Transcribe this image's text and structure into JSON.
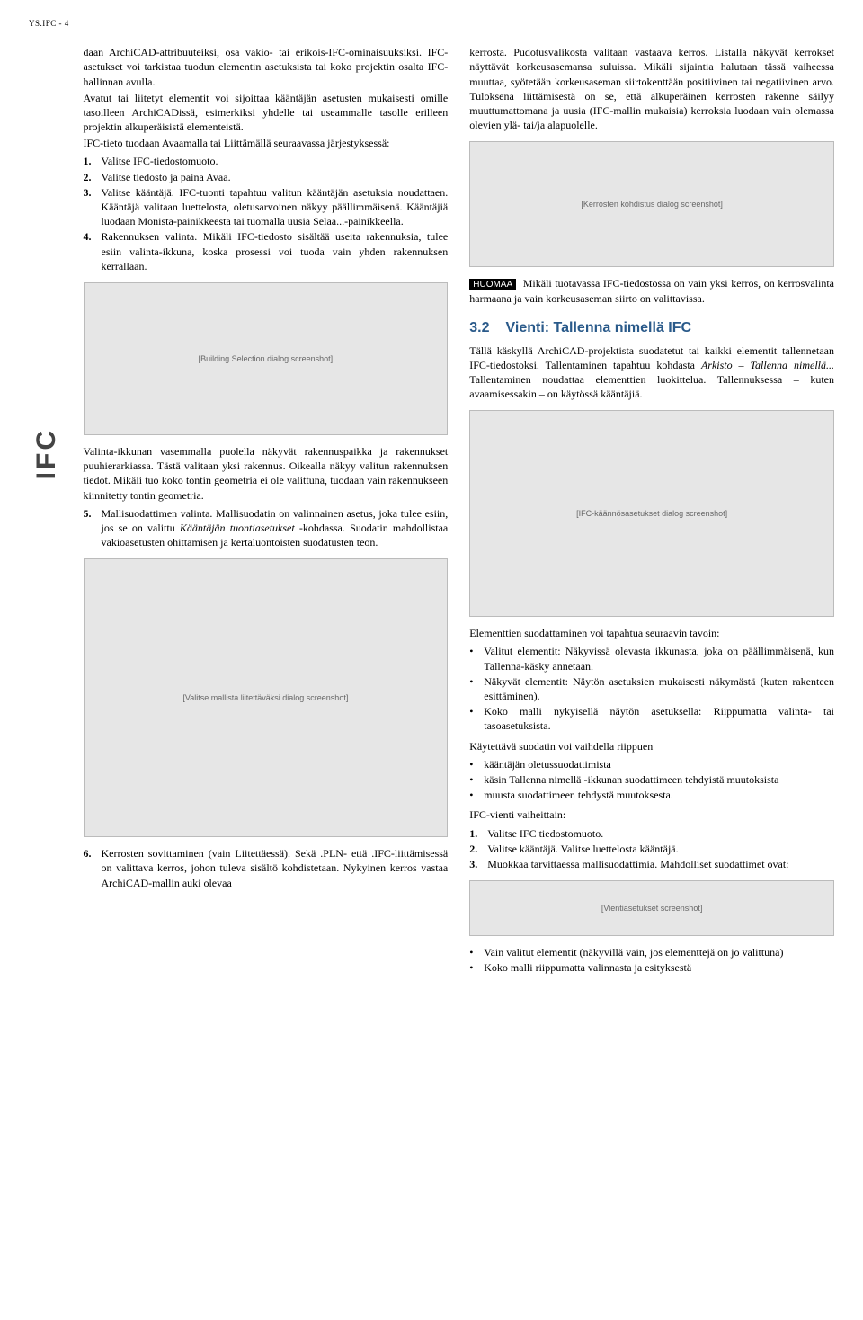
{
  "header": "YS.IFC - 4",
  "sideTab": "IFC",
  "left": {
    "p1": "daan ArchiCAD-attribuuteiksi, osa vakio- tai erikois-IFC-ominaisuuksiksi. IFC-asetukset voi tarkistaa tuodun elementin asetuksista tai koko projektin osalta IFC-hallinnan avulla.",
    "p2": "Avatut tai liitetyt elementit voi sijoittaa kääntäjän asetusten mukaisesti omille tasoilleen ArchiCADissä, esimerkiksi yhdelle tai useammalle tasolle erilleen projektin alkuperäisistä elementeistä.",
    "p3": "IFC-tieto tuodaan Avaamalla tai Liittämällä seuraavassa järjestyksessä:",
    "list1": [
      {
        "n": "1.",
        "t": "Valitse IFC-tiedostomuoto."
      },
      {
        "n": "2.",
        "t": "Valitse tiedosto ja paina Avaa."
      },
      {
        "n": "3.",
        "t": "Valitse kääntäjä. IFC-tuonti tapahtuu valitun kääntäjän asetuksia noudattaen. Kääntäjä valitaan luettelosta, oletusarvoinen näkyy päällimmäisenä. Kääntäjiä luodaan Monista-painikkeesta tai tuomalla uusia Selaa...-painikkeella."
      },
      {
        "n": "4.",
        "t": "Rakennuksen valinta.  Mikäli IFC-tiedosto sisältää useita rakennuksia, tulee esiin valinta-ikkuna, koska prosessi voi tuoda vain yhden rakennuksen kerrallaan."
      }
    ],
    "img1": "[Building Selection dialog screenshot]",
    "p4": "Valinta-ikkunan vasemmalla puolella näkyvät rakennuspaikka ja rakennukset puuhierarkiassa. Tästä valitaan yksi rakennus. Oikealla näkyy valitun rakennuksen tiedot. Mikäli tuo koko tontin geometria ei ole valittuna, tuodaan vain rakennukseen kiinnitetty tontin geometria.",
    "list2": [
      {
        "n": "5.",
        "t": "Mallisuodattimen valinta. Mallisuodatin on valinnainen asetus, joka tulee esiin, jos se on valittu ",
        "ti": "Kääntäjän tuontiasetukset",
        "te": " -kohdassa. Suodatin mahdollistaa vakioasetusten ohittamisen ja kertaluontoisten suodatusten teon."
      }
    ],
    "img2": "[Valitse mallista liitettäväksi dialog screenshot]",
    "list3": [
      {
        "n": "6.",
        "t": "Kerrosten sovittaminen (vain Liitettäessä). Sekä .PLN- että .IFC-liittämisessä on valittava kerros, johon tuleva sisältö kohdistetaan. Nykyinen kerros vastaa ArchiCAD-mallin auki olevaa"
      }
    ]
  },
  "right": {
    "p1": "kerrosta. Pudotusvalikosta valitaan vastaava kerros. Listalla näkyvät kerrokset näyttävät korkeusasemansa suluissa. Mikäli sijaintia halutaan tässä vaiheessa muuttaa, syötetään korkeusaseman siirtokenttään positiivinen tai negatiivinen arvo. Tuloksena liittämisestä on se, että alkuperäinen kerrosten rakenne säilyy muuttumattomana ja uusia (IFC-mallin mukaisia) kerroksia luodaan vain olemassa olevien ylä- tai/ja alapuolelle.",
    "img1": "[Kerrosten kohdistus dialog screenshot]",
    "huomaaLabel": "HUOMAA",
    "p2": " Mikäli tuotavassa IFC-tiedostossa on vain yksi kerros, on kerrosvalinta harmaana ja vain korkeusaseman siirto on valittavissa.",
    "sectionNum": "3.2",
    "sectionTitle": "Vienti: Tallenna nimellä IFC",
    "p3a": "Tällä käskyllä ArchiCAD-projektista suodatetut tai kaikki elementit tallennetaan IFC-tiedostoksi. Tallentaminen tapahtuu kohdasta ",
    "p3i": "Arkisto – Tallenna nimellä...",
    "p3b": " Tallentaminen noudattaa elementtien luokittelua. Tallennuksessa – kuten avaamisessakin – on käytössä kääntäjiä.",
    "img2": "[IFC-käännösasetukset dialog screenshot]",
    "p4": "Elementtien suodattaminen voi tapahtua seuraavin tavoin:",
    "bul1": [
      "Valitut elementit: Näkyvissä olevasta ikkunasta, joka on päällimmäisenä, kun Tallenna-käsky annetaan.",
      "Näkyvät elementit: Näytön asetuksien mukaisesti näkymästä (kuten rakenteen esittäminen).",
      "Koko malli nykyisellä näytön asetuksella: Riippumatta valinta- tai tasoasetuksista."
    ],
    "p5": "Käytettävä suodatin voi vaihdella riippuen",
    "bul2": [
      "kääntäjän oletussuodattimista",
      "käsin Tallenna nimellä -ikkunan suodattimeen tehdyistä muutoksista",
      "muusta suodattimeen tehdystä muutoksesta."
    ],
    "p6": "IFC-vienti vaiheittain:",
    "list1": [
      {
        "n": "1.",
        "t": "Valitse IFC tiedostomuoto."
      },
      {
        "n": "2.",
        "t": "Valitse kääntäjä. Valitse luettelosta kääntäjä."
      },
      {
        "n": "3.",
        "t": "Muokkaa tarvittaessa mallisuodattimia. Mahdolliset suodattimet ovat:"
      }
    ],
    "img3": "[Vientiasetukset screenshot]",
    "bul3": [
      "Vain valitut elementit (näkyvillä vain, jos elementtejä on jo valittuna)",
      "Koko malli riippumatta valinnasta ja esityksestä"
    ]
  }
}
